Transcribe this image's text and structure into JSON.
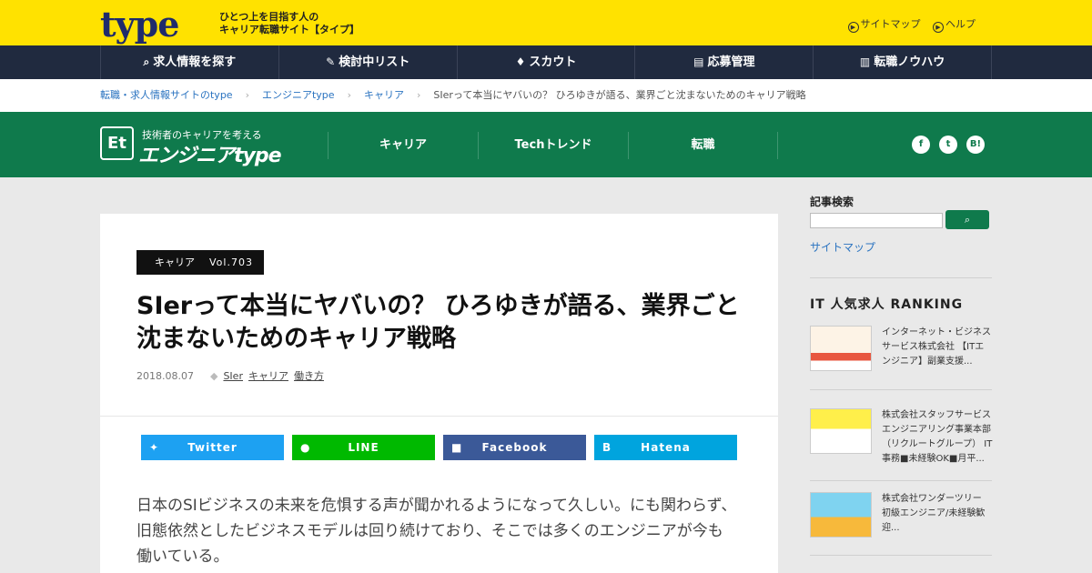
{
  "top": {
    "logo": "type",
    "tagline1": "ひとつ上を目指す人の",
    "tagline2": "キャリア転職サイト【タイプ】",
    "sitemap": "サイトマップ",
    "help": "ヘルプ"
  },
  "nav": [
    {
      "label": "求人情報を探す",
      "icon": "search-icon"
    },
    {
      "label": "検討中リスト",
      "icon": "clip-icon"
    },
    {
      "label": "スカウト",
      "icon": "thumb-icon"
    },
    {
      "label": "応募管理",
      "icon": "form-icon"
    },
    {
      "label": "転職ノウハウ",
      "icon": "book-icon"
    }
  ],
  "breadcrumb": {
    "items": [
      "転職・求人情報サイトのtype",
      "エンジニアtype",
      "キャリア"
    ],
    "current": "SIerって本当にヤバいの？ ひろゆきが語る、業界ごと沈まないためのキャリア戦略"
  },
  "brand": {
    "mark": "Et",
    "sub": "技術者のキャリアを考える",
    "name": "エンジニアtype"
  },
  "gnav": [
    "キャリア",
    "Techトレンド",
    "転職"
  ],
  "social": {
    "facebook": "f",
    "twitter": "t",
    "hatena": "B!"
  },
  "article": {
    "category": "キャリア",
    "vol": "Vol.703",
    "title": "SIerって本当にヤバいの？ ひろゆきが語る、業界ごと沈まないためのキャリア戦略",
    "date": "2018.08.07",
    "tags": [
      "SIer",
      "キャリア",
      "働き方"
    ],
    "body": "日本のSIビジネスの未来を危惧する声が聞かれるようになって久しい。にも関わらず、旧態依然としたビジネスモデルは回り続けており、そこでは多くのエンジニアが今も働いている。"
  },
  "share": {
    "twitter": "Twitter",
    "line": "LINE",
    "facebook": "Facebook",
    "hatena": "Hatena"
  },
  "sidebar": {
    "search_label": "記事検索",
    "sitemap": "サイトマップ",
    "ranking_title": "IT 人気求人 RANKING",
    "ranking": [
      {
        "text": "インターネット・ビジネスサービス株式会社 【ITエンジニア】副業支援..."
      },
      {
        "text": "株式会社スタッフサービス エンジニアリング事業本部 （リクルートグループ） IT事務■未経験OK■月平..."
      },
      {
        "text": "株式会社ワンダーツリー 初級エンジニア/未経験歓迎..."
      }
    ]
  },
  "colors": {
    "yellow": "#ffe200",
    "navy": "#202a3f",
    "green": "#0f7a4c",
    "twitter": "#1da1f2",
    "line": "#00b900",
    "facebook": "#3b5998",
    "hatena": "#00a4de"
  }
}
